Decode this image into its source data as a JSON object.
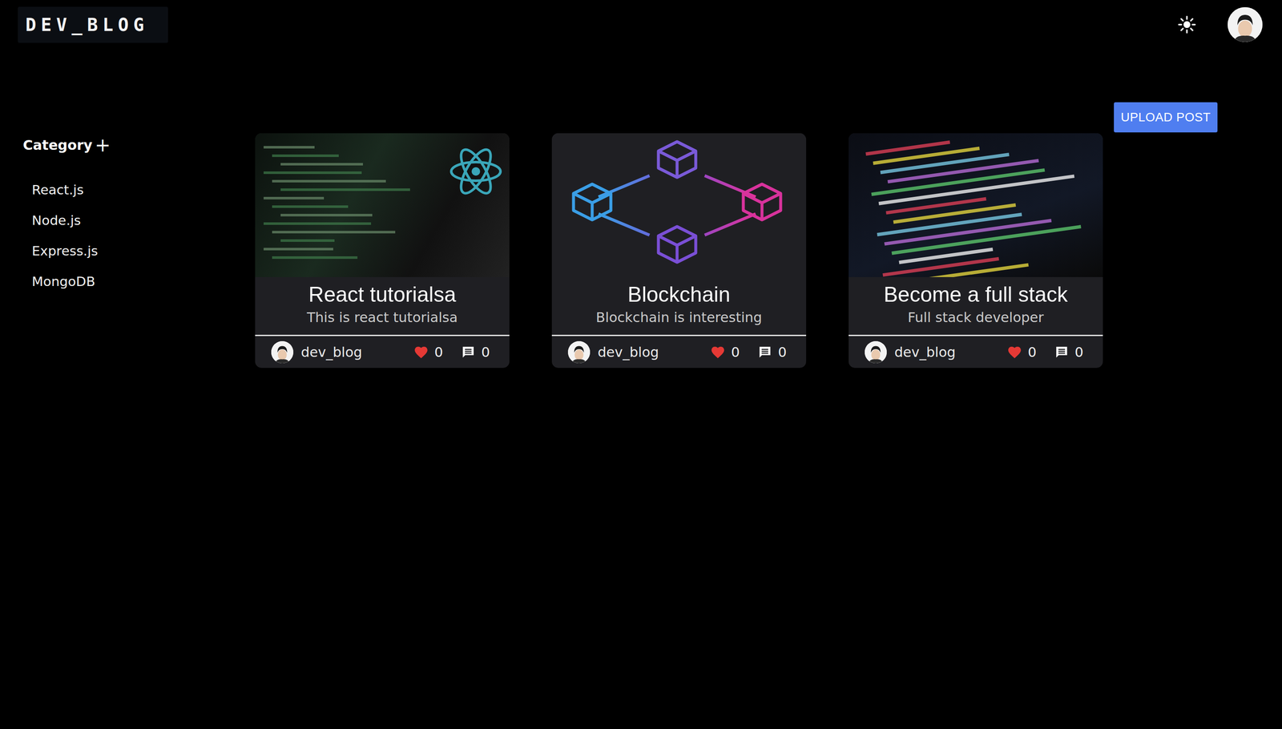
{
  "header": {
    "logo": "DEV_BLOG"
  },
  "upload_button": "UPLOAD POST",
  "sidebar": {
    "title": "Category",
    "add": "+",
    "items": [
      "React.js",
      "Node.js",
      "Express.js",
      "MongoDB"
    ]
  },
  "posts": [
    {
      "title": "React tutorialsa",
      "subtitle": "This is react tutorialsa",
      "author": "dev_blog",
      "likes": "0",
      "comments": "0",
      "kind": "code-react"
    },
    {
      "title": "Blockchain",
      "subtitle": "Blockchain is interesting",
      "author": "dev_blog",
      "likes": "0",
      "comments": "0",
      "kind": "blockchain"
    },
    {
      "title": "Become a full stack",
      "subtitle": "Full stack developer",
      "author": "dev_blog",
      "likes": "0",
      "comments": "0",
      "kind": "code-html"
    }
  ]
}
